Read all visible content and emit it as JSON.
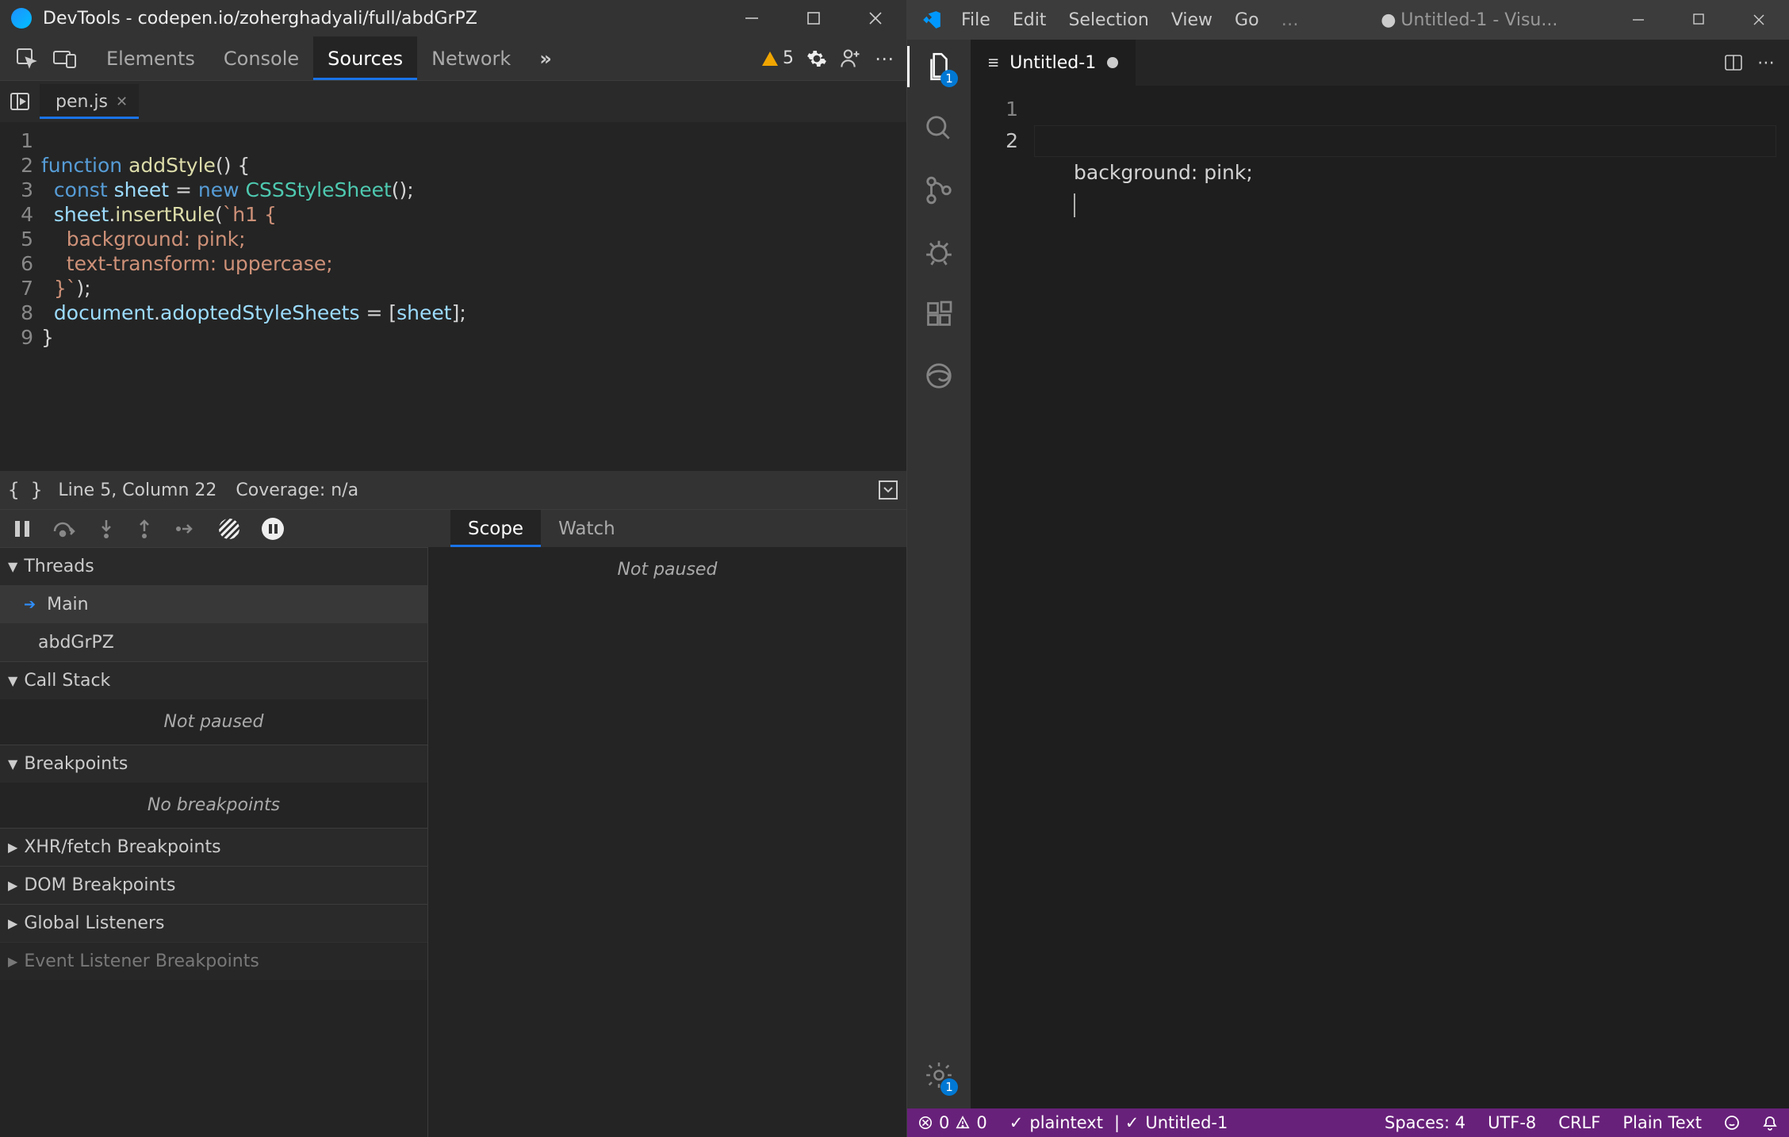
{
  "devtools": {
    "title": "DevTools - codepen.io/zoherghadyali/full/abdGrPZ",
    "tabs": [
      "Elements",
      "Console",
      "Sources",
      "Network"
    ],
    "active_tab": "Sources",
    "issues_count": "5",
    "file_tab": "pen.js",
    "code_lines": [
      "1",
      "2",
      "3",
      "4",
      "5",
      "6",
      "7",
      "8",
      "9"
    ],
    "code": {
      "l1": "",
      "l2_kw1": "function",
      "l2_fn": "addStyle",
      "l2_rest": "() {",
      "l3_kw1": "const",
      "l3_id": "sheet",
      "l3_eq": " = ",
      "l3_kw2": "new",
      "l3_cls": "CSSStyleSheet",
      "l3_end": "();",
      "l4_id": "sheet",
      "l4_dot": ".",
      "l4_fn": "insertRule",
      "l4_open": "(",
      "l4_str": "`h1 {",
      "l5_str": "    background: pink;",
      "l6_str": "    text-transform: uppercase;",
      "l7_str": "  }`",
      "l7_close": ");",
      "l8_id1": "document",
      "l8_dot": ".",
      "l8_prop": "adoptedStyleSheets",
      "l8_mid": " = [",
      "l8_id2": "sheet",
      "l8_end": "];",
      "l9": "}"
    },
    "status": {
      "pos": "Line 5, Column 22",
      "cov": "Coverage: n/a"
    },
    "scope_tabs": [
      "Scope",
      "Watch"
    ],
    "scope_msg": "Not paused",
    "panels": {
      "threads": "Threads",
      "thread_main": "Main",
      "thread_sub": "abdGrPZ",
      "callstack": "Call Stack",
      "callstack_msg": "Not paused",
      "breakpoints": "Breakpoints",
      "breakpoints_msg": "No breakpoints",
      "xhr": "XHR/fetch Breakpoints",
      "dom": "DOM Breakpoints",
      "global": "Global Listeners",
      "event": "Event Listener Breakpoints"
    }
  },
  "vscode": {
    "menus": [
      "File",
      "Edit",
      "Selection",
      "View",
      "Go"
    ],
    "menu_more": "…",
    "title_dot": "●",
    "title": "Untitled-1 - Visu...",
    "tab_name": "Untitled-1",
    "activity_badge": "1",
    "manage_badge": "1",
    "lines": [
      "1",
      "2"
    ],
    "line1": "background: pink;",
    "status": {
      "errors": "0",
      "warnings": "0",
      "plaintext": "plaintext",
      "file": "Untitled-1",
      "spaces": "Spaces: 4",
      "enc": "UTF-8",
      "eol": "CRLF",
      "lang": "Plain Text"
    }
  }
}
